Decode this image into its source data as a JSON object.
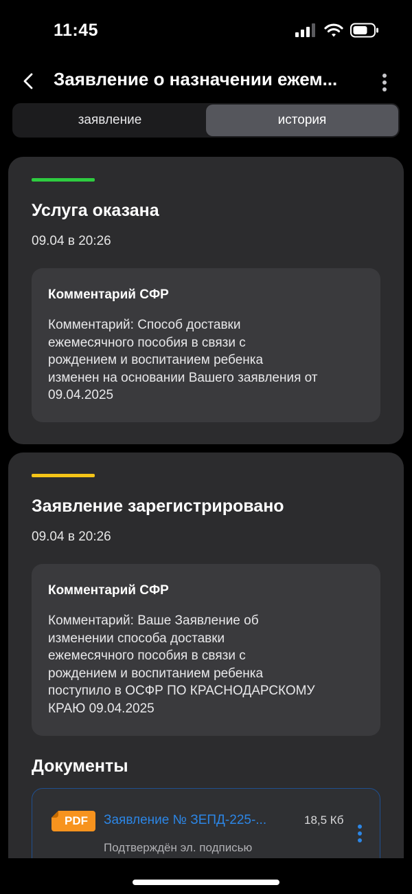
{
  "status_bar": {
    "time": "11:45"
  },
  "header": {
    "title": "Заявление о назначении ежем..."
  },
  "tabs": [
    {
      "label": "заявление",
      "active": false
    },
    {
      "label": "история",
      "active": true
    }
  ],
  "history": [
    {
      "status": "Услуга оказана",
      "bar_color": "#2ecc40",
      "date": "09.04 в 20:26",
      "comment_title": "Комментарий СФР",
      "comment_lines": [
        "Комментарий: Способ доставки",
        "ежемесячного пособия в связи с",
        "рождением и воспитанием ребенка",
        "изменен на основании Вашего заявления от",
        "09.04.2025"
      ]
    },
    {
      "status": "Заявление зарегистрировано",
      "bar_color": "#f5c518",
      "date": "09.04 в 20:26",
      "comment_title": "Комментарий СФР",
      "comment_lines": [
        "Комментарий: Ваше Заявление об",
        "изменении способа доставки",
        "ежемесячного пособия в связи с",
        "рождением и воспитанием ребенка",
        "поступило в ОСФР ПО КРАСНОДАРСКОМУ",
        "КРАЮ 09.04.2025"
      ]
    }
  ],
  "documents": {
    "title": "Документы",
    "items": [
      {
        "badge": "PDF",
        "name": "Заявление № ЗЕПД-225-...",
        "size": "18,5 Кб",
        "signature": "Подтверждён эл. подписью"
      }
    ]
  },
  "colors": {
    "accent_blue": "#2c86e6",
    "pdf_orange": "#f7931e"
  }
}
